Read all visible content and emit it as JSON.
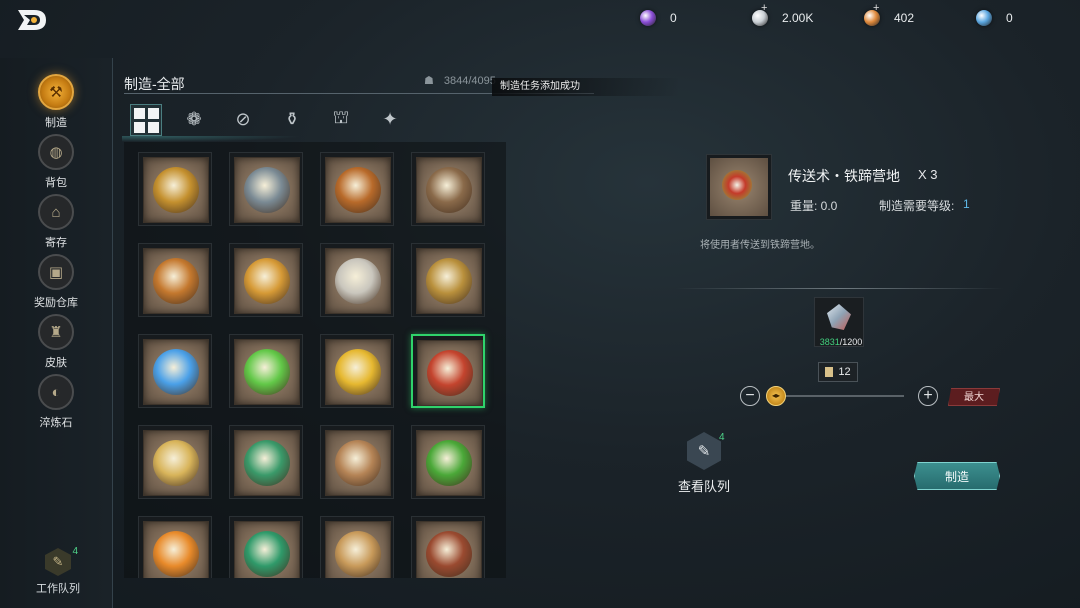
{
  "currencies": [
    {
      "name": "purple-gem",
      "value": "0",
      "color": "#8a4dd6",
      "plus": false
    },
    {
      "name": "silver-coin",
      "value": "2.00K",
      "color": "#c9cfd4",
      "plus": true
    },
    {
      "name": "gold-coin",
      "value": "402",
      "color": "#e08a3c",
      "plus": true
    },
    {
      "name": "blue-crystal",
      "value": "0",
      "color": "#5aa6e0",
      "plus": false
    }
  ],
  "nav": {
    "items": [
      {
        "label": "制造",
        "icon": "hammer-icon",
        "glyph": "⚒",
        "active": true
      },
      {
        "label": "背包",
        "icon": "bag-icon",
        "glyph": "◍",
        "active": false
      },
      {
        "label": "寄存",
        "icon": "house-icon",
        "glyph": "⌂",
        "active": false
      },
      {
        "label": "奖励仓库",
        "icon": "chest-icon",
        "glyph": "▣",
        "active": false
      },
      {
        "label": "皮肤",
        "icon": "armor-icon",
        "glyph": "♜",
        "active": false
      },
      {
        "label": "淬炼石",
        "icon": "stone-icon",
        "glyph": "◐",
        "active": false
      }
    ],
    "queue_label": "工作队列",
    "queue_badge": "4"
  },
  "section": {
    "title": "制造-全部",
    "capacity": "3844/4095",
    "toast": "制造任务添加成功"
  },
  "categories": [
    {
      "icon": "all-grid-icon",
      "glyph": "",
      "active": true
    },
    {
      "icon": "materials-icon",
      "glyph": "❁",
      "active": false
    },
    {
      "icon": "tools-icon",
      "glyph": "⊘",
      "active": false
    },
    {
      "icon": "potion-icon",
      "glyph": "⚱",
      "active": false
    },
    {
      "icon": "building-icon",
      "glyph": "⛫",
      "active": false
    },
    {
      "icon": "misc-icon",
      "glyph": "✦",
      "active": false
    }
  ],
  "items": [
    {
      "icon": "food-platter-icon",
      "color": "#c4902e"
    },
    {
      "icon": "campfire-icon",
      "color": "#7a8a94"
    },
    {
      "icon": "axe-icon",
      "color": "#b86a2a"
    },
    {
      "icon": "pickaxe-icon",
      "color": "#8a6a4a"
    },
    {
      "icon": "sickle-icon",
      "color": "#c4782e"
    },
    {
      "icon": "curved-blade-icon",
      "color": "#d69a36"
    },
    {
      "icon": "crowbar-icon",
      "color": "#c9c6bd"
    },
    {
      "icon": "shovel-icon",
      "color": "#b9903c"
    },
    {
      "icon": "blue-rune-scroll-icon",
      "color": "#4aa0e8"
    },
    {
      "icon": "green-rune-scroll-icon",
      "color": "#62c848"
    },
    {
      "icon": "gold-rune-scroll-icon",
      "color": "#e6b830"
    },
    {
      "icon": "teleport-scroll-icon",
      "color": "#c4442e",
      "selected": true
    },
    {
      "icon": "gold-scroll-icon",
      "color": "#d8b45a"
    },
    {
      "icon": "green-seal-scroll-icon",
      "color": "#3a9a6a"
    },
    {
      "icon": "grain-pile-icon",
      "color": "#b58456"
    },
    {
      "icon": "herb-leaf-icon",
      "color": "#4aa838"
    },
    {
      "icon": "orange-beads-icon",
      "color": "#e88a2a"
    },
    {
      "icon": "green-potion-icon",
      "color": "#2f9a6a"
    },
    {
      "icon": "parchment-pack-icon",
      "color": "#c89a5a"
    },
    {
      "icon": "leather-pouch-icon",
      "color": "#9a4a30"
    }
  ],
  "detail": {
    "name": "传送术・铁蹄营地",
    "qty": "X 3",
    "weight_label": "重量: 0.0",
    "req_label": "制造需要等级:",
    "req_value": "1",
    "description": "将使用者传送到铁蹄营地。",
    "material": {
      "icon": "crystal-shard-icon",
      "have": "3831",
      "need": "/1200"
    },
    "count": "12",
    "max_label": "最大",
    "craft_label": "制造",
    "view_queue_label": "查看队列",
    "view_queue_badge": "4"
  }
}
